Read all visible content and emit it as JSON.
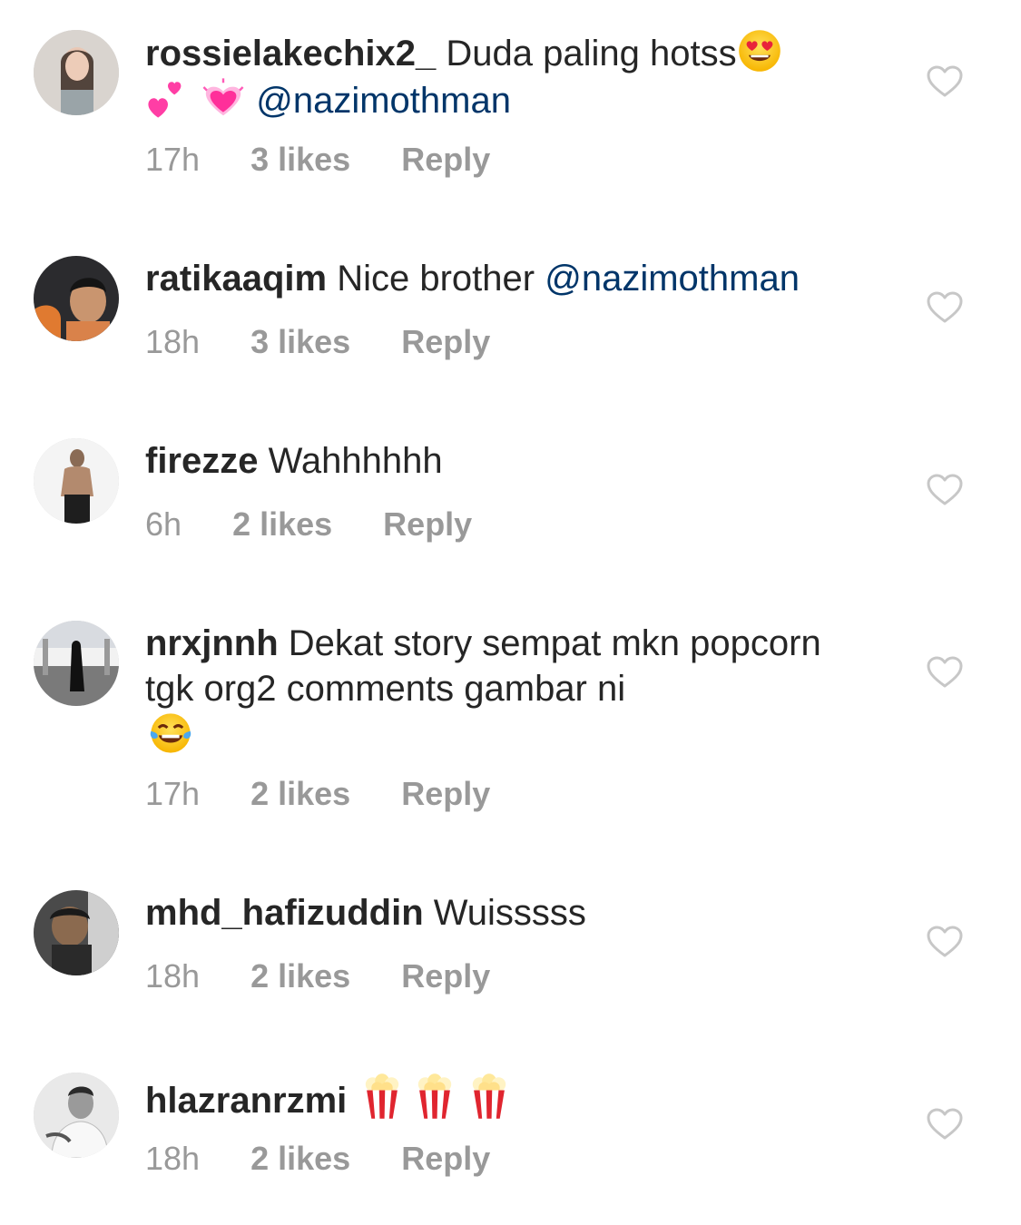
{
  "comments": [
    {
      "username": "rossielakechix2_",
      "text": "Duda paling hotss",
      "emojis_after_text": [
        "heart-eyes-emoji"
      ],
      "line2_emojis": [
        "two-hearts-emoji",
        "growing-heart-emoji"
      ],
      "mention": "@nazimothman",
      "time": "17h",
      "likes": "3 likes",
      "reply": "Reply"
    },
    {
      "username": "ratikaaqim",
      "text": "Nice brother",
      "mention": "@nazimothman",
      "time": "18h",
      "likes": "3 likes",
      "reply": "Reply"
    },
    {
      "username": "firezze",
      "text": "Wahhhhhh",
      "time": "6h",
      "likes": "2 likes",
      "reply": "Reply"
    },
    {
      "username": "nrxjnnh",
      "text": "Dekat story sempat mkn popcorn tgk org2 comments gambar ni",
      "emojis_after_text": [
        "tears-of-joy-emoji"
      ],
      "time": "17h",
      "likes": "2 likes",
      "reply": "Reply"
    },
    {
      "username": "mhd_hafizuddin",
      "text": "Wuisssss",
      "time": "18h",
      "likes": "2 likes",
      "reply": "Reply"
    },
    {
      "username": "hlazranrzmi",
      "text": "",
      "emojis_after_text": [
        "popcorn-emoji",
        "popcorn-emoji",
        "popcorn-emoji"
      ],
      "time": "18h",
      "likes": "2 likes",
      "reply": "Reply"
    }
  ],
  "icons": {
    "like": "heart-outline-icon"
  },
  "colors": {
    "username": "#262626",
    "mention": "#003569",
    "meta": "#999999",
    "heart_outline": "#c7c7c7"
  }
}
